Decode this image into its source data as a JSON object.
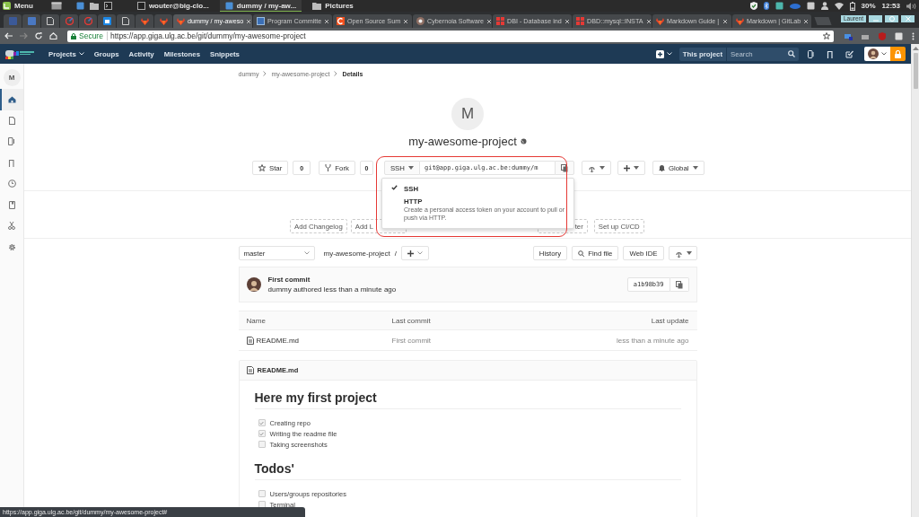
{
  "os_panel": {
    "menu": "Menu",
    "windows": [
      {
        "title": "wouter@big-clo...",
        "selected": false
      },
      {
        "title": "dummy / my-aw...",
        "selected": true
      },
      {
        "title": "Pictures",
        "selected": false
      }
    ],
    "battery": "30%",
    "clock": "12:53"
  },
  "browser": {
    "tabs": [
      {
        "title": "dummy / my-aweso",
        "kind": "gitlab",
        "selected": true
      },
      {
        "title": "Program Committe",
        "kind": "blue",
        "selected": false
      },
      {
        "title": "Open Source Sum",
        "kind": "orange",
        "selected": false
      },
      {
        "title": "Cybernoia Software",
        "kind": "camera",
        "selected": false
      },
      {
        "title": "DBI - Database ind",
        "kind": "grid",
        "selected": false
      },
      {
        "title": "DBD::mysql::INSTA",
        "kind": "grid",
        "selected": false
      },
      {
        "title": "Markdown Guide |",
        "kind": "gitlab",
        "selected": false
      },
      {
        "title": "Markdown | GitLab",
        "kind": "gitlab",
        "selected": false
      }
    ],
    "profile": "Laurent",
    "security": "Secure",
    "url": "https://app.giga.ulg.ac.be/git/dummy/my-awesome-project"
  },
  "navbar": {
    "links": [
      {
        "label": "Projects",
        "dropdown": true
      },
      {
        "label": "Groups",
        "dropdown": false
      },
      {
        "label": "Activity",
        "dropdown": false
      },
      {
        "label": "Milestones",
        "dropdown": false
      },
      {
        "label": "Snippets",
        "dropdown": false
      }
    ],
    "scope": "This project",
    "search": {
      "placeholder": "Search"
    }
  },
  "sidebar": {
    "initial": "M",
    "items": [
      {
        "kind": "home",
        "selected": true
      },
      {
        "kind": "repository",
        "selected": false
      },
      {
        "kind": "issues",
        "selected": false
      },
      {
        "kind": "merge",
        "selected": false
      },
      {
        "kind": "pipelines",
        "selected": false
      },
      {
        "kind": "wiki",
        "selected": false
      },
      {
        "kind": "snippets",
        "selected": false
      },
      {
        "kind": "settings",
        "selected": false
      }
    ]
  },
  "breadcrumb": [
    "dummy",
    "my-awesome-project",
    "Details"
  ],
  "project": {
    "initial": "M",
    "name": "my-awesome-project",
    "star": {
      "label": "Star",
      "count": "0"
    },
    "fork": {
      "label": "Fork",
      "count": "0"
    },
    "clone": {
      "protocol": "SSH",
      "url": "git@app.giga.ulg.ac.be:dummy/m",
      "menu": [
        {
          "label": "SSH",
          "selected": true
        },
        {
          "label": "HTTP",
          "selected": false,
          "description": "Create a personal access token on your account to pull or push via HTTP."
        }
      ]
    },
    "notification": "Global"
  },
  "quick_actions": [
    {
      "label": "Add Changelog"
    },
    {
      "label": "Add L"
    },
    {
      "label": "ter"
    },
    {
      "label": "Set up CI/CD"
    }
  ],
  "repo": {
    "branch": "master",
    "path": "my-awesome-project",
    "separator": "/",
    "actions": [
      "History",
      "Find file",
      "Web IDE"
    ]
  },
  "last_commit": {
    "title": "First commit",
    "author_line": "dummy authored less than a minute ago",
    "sha": "a1b98b39"
  },
  "files": {
    "columns": [
      "Name",
      "Last commit",
      "Last update"
    ],
    "rows": [
      {
        "name": "README.md",
        "commit": "First commit",
        "updated": "less than a minute ago"
      }
    ]
  },
  "readme": {
    "filename": "README.md",
    "sections": [
      {
        "heading": "Here my first project",
        "tasks": [
          {
            "text": "Creating repo",
            "checked": true
          },
          {
            "text": "Writing the readme file",
            "checked": true
          },
          {
            "text": "Taking screenshots",
            "checked": false
          }
        ]
      },
      {
        "heading": "Todos'",
        "tasks": [
          {
            "text": "Users/groups repositories",
            "checked": false
          },
          {
            "text": "Terminal",
            "checked": false
          }
        ]
      }
    ]
  },
  "status_url": "https://app.giga.ulg.ac.be/git/dummy/my-awesome-project#"
}
